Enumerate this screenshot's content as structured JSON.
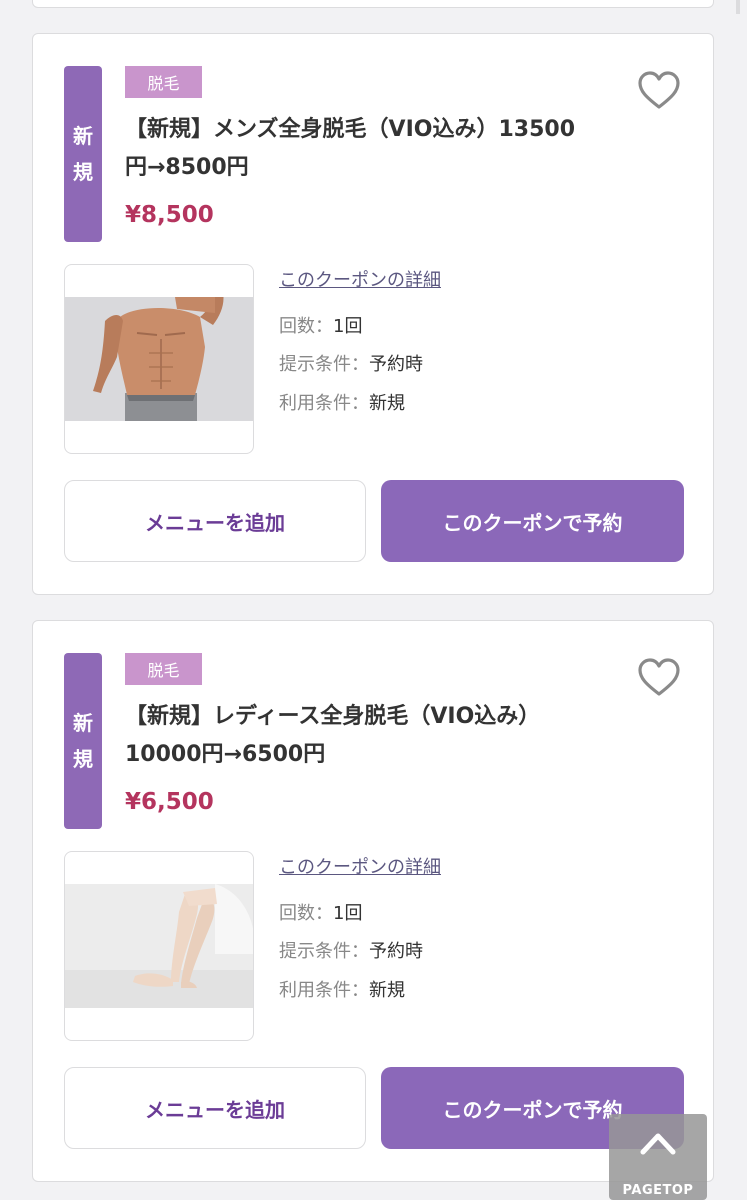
{
  "coupons": [
    {
      "badge_new": [
        "新",
        "規"
      ],
      "category": "脱毛",
      "title": "【新規】メンズ全身脱毛（VIO込み）13500円→8500円",
      "price": "¥8,500",
      "detail_link": "このクーポンの詳細",
      "count_label": "回数：",
      "count_value": "1回",
      "present_label": "提示条件：",
      "present_value": "予約時",
      "usage_label": "利用条件：",
      "usage_value": "新規",
      "add_menu_label": "メニューを追加",
      "reserve_label": "このクーポンで予約"
    },
    {
      "badge_new": [
        "新",
        "規"
      ],
      "category": "脱毛",
      "title": "【新規】レディース全身脱毛（VIO込み）10000円→6500円",
      "price": "¥6,500",
      "detail_link": "このクーポンの詳細",
      "count_label": "回数：",
      "count_value": "1回",
      "present_label": "提示条件：",
      "present_value": "予約時",
      "usage_label": "利用条件：",
      "usage_value": "新規",
      "add_menu_label": "メニューを追加",
      "reserve_label": "このクーポンで予約"
    }
  ],
  "pagetop": {
    "label": "PAGETOP",
    "icon": "chevron-up-icon"
  },
  "colors": {
    "accent": "#8b68b9",
    "badge_new": "#8e69b6",
    "category": "#c995cc",
    "price": "#b4345e",
    "link": "#5b5780",
    "add_button_text": "#6b3c96"
  }
}
